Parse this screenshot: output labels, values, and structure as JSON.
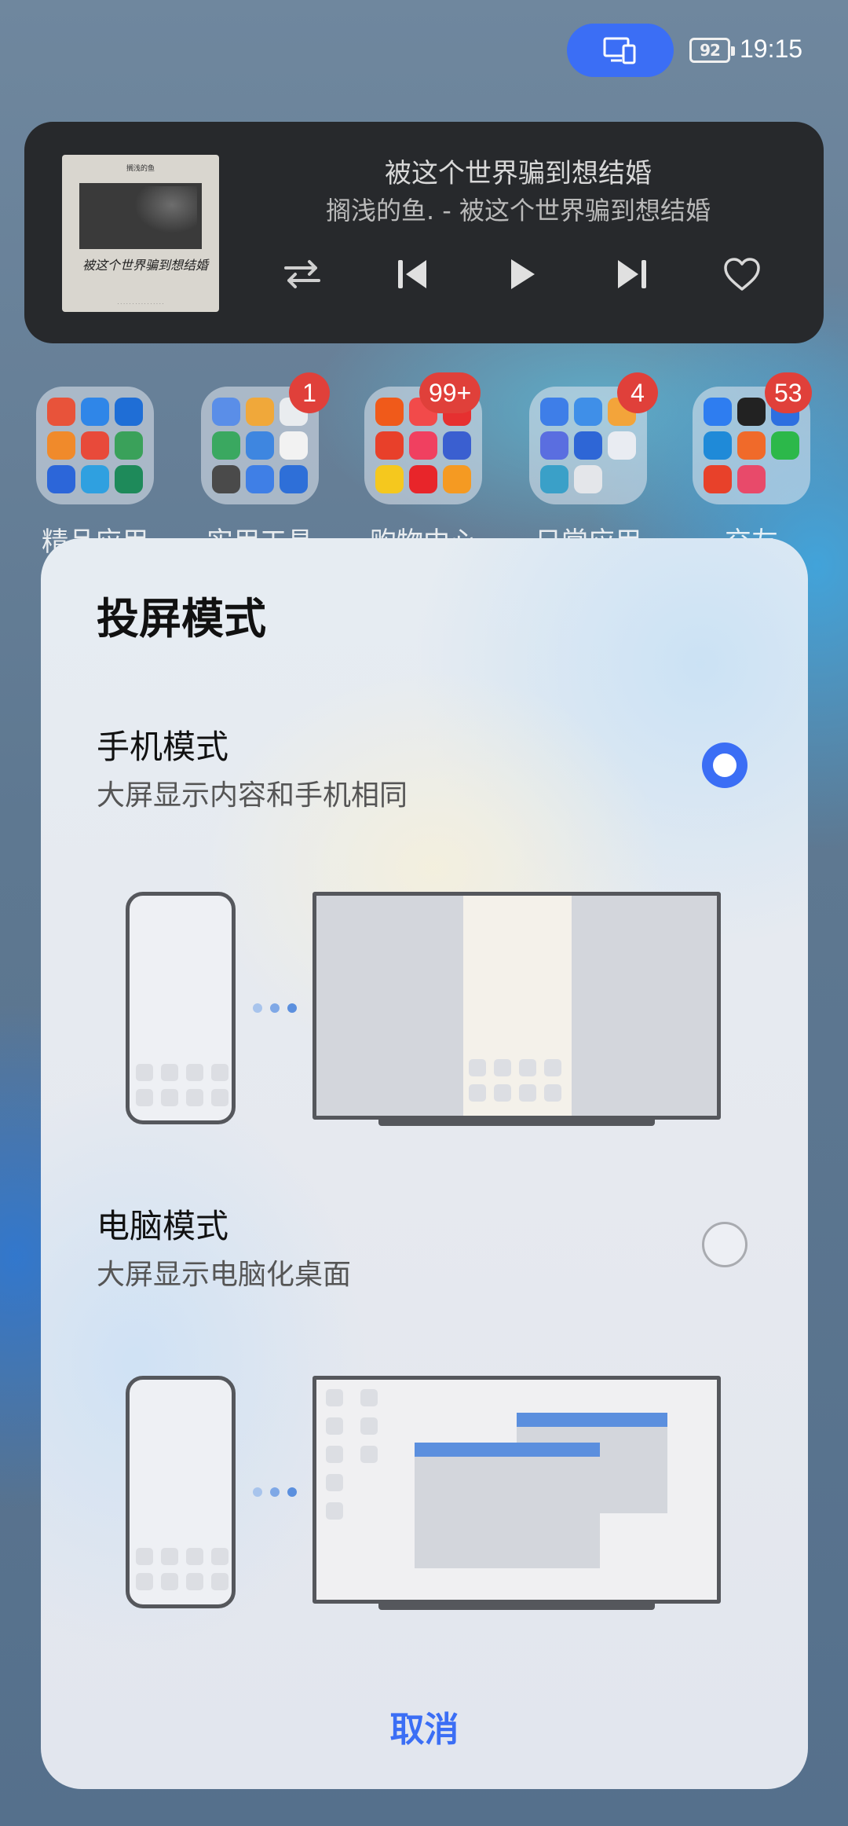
{
  "status_bar": {
    "battery": "92",
    "time": "19:15",
    "cast_icon": "screen-cast-icon"
  },
  "music": {
    "album_art_label": "被这个世界骗到想结婚",
    "title": "被这个世界骗到想结婚",
    "subtitle": "搁浅的鱼. - 被这个世界骗到想结婚",
    "controls": [
      "repeat-icon",
      "previous-icon",
      "play-icon",
      "next-icon",
      "heart-icon"
    ]
  },
  "folders": [
    {
      "label": "精品应用",
      "badge": ""
    },
    {
      "label": "实用工具",
      "badge": "1"
    },
    {
      "label": "购物中心",
      "badge": "99+"
    },
    {
      "label": "日常应用",
      "badge": "4"
    },
    {
      "label": "交友",
      "badge": "53"
    }
  ],
  "sheet": {
    "title": "投屏模式",
    "options": [
      {
        "title": "手机模式",
        "description": "大屏显示内容和手机相同",
        "selected": true
      },
      {
        "title": "电脑模式",
        "description": "大屏显示电脑化桌面",
        "selected": false
      }
    ],
    "cancel_label": "取消"
  },
  "colors": {
    "accent": "#3b6ef5",
    "badge": "#e0403a",
    "window_bar": "#5b8fde"
  }
}
